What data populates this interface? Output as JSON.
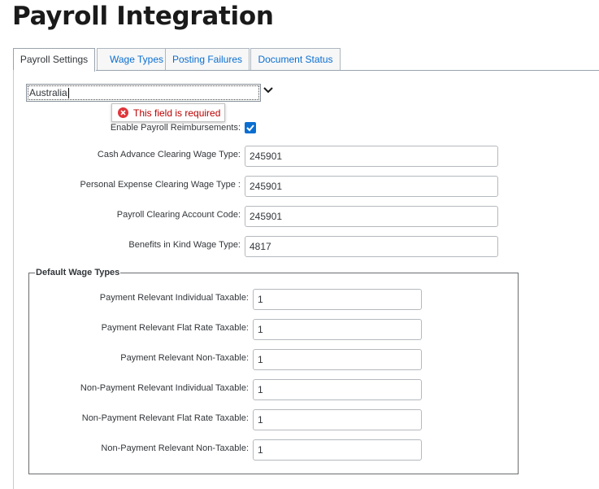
{
  "page": {
    "title": "Payroll Integration"
  },
  "tabs": [
    {
      "label": "Payroll Settings",
      "active": true
    },
    {
      "label": "Wage Types",
      "active": false
    },
    {
      "label": "Posting Failures",
      "active": false
    },
    {
      "label": "Document Status",
      "active": false
    }
  ],
  "country": {
    "value": "Australia",
    "icon": "chevron-down-icon"
  },
  "validation": {
    "message": "This field is required",
    "icon": "error-circle-icon",
    "color": "#bb0000"
  },
  "settings": {
    "reimbursements_label": "Enable Payroll Reimbursements:",
    "reimbursements_checked": true,
    "cash_advance_label": "Cash Advance Clearing Wage Type:",
    "cash_advance_value": "245901",
    "personal_expense_label": "Personal Expense Clearing Wage Type :",
    "personal_expense_value": "245901",
    "clearing_account_label": "Payroll Clearing Account Code:",
    "clearing_account_value": "245901",
    "benefits_label": "Benefits in Kind Wage Type:",
    "benefits_value": "4817"
  },
  "default_wage_types": {
    "legend": "Default Wage Types",
    "fields": [
      {
        "label": "Payment Relevant Individual Taxable:",
        "value": "1"
      },
      {
        "label": "Payment Relevant Flat Rate Taxable:",
        "value": "1"
      },
      {
        "label": "Payment Relevant Non-Taxable:",
        "value": "1"
      },
      {
        "label": "Non-Payment Relevant Individual Taxable:",
        "value": "1"
      },
      {
        "label": "Non-Payment Relevant Flat Rate Taxable:",
        "value": "1"
      },
      {
        "label": "Non-Payment Relevant Non-Taxable:",
        "value": "1"
      }
    ]
  },
  "colors": {
    "accent": "#0a6ed1",
    "error": "#bb0000",
    "text": "#32363a"
  }
}
